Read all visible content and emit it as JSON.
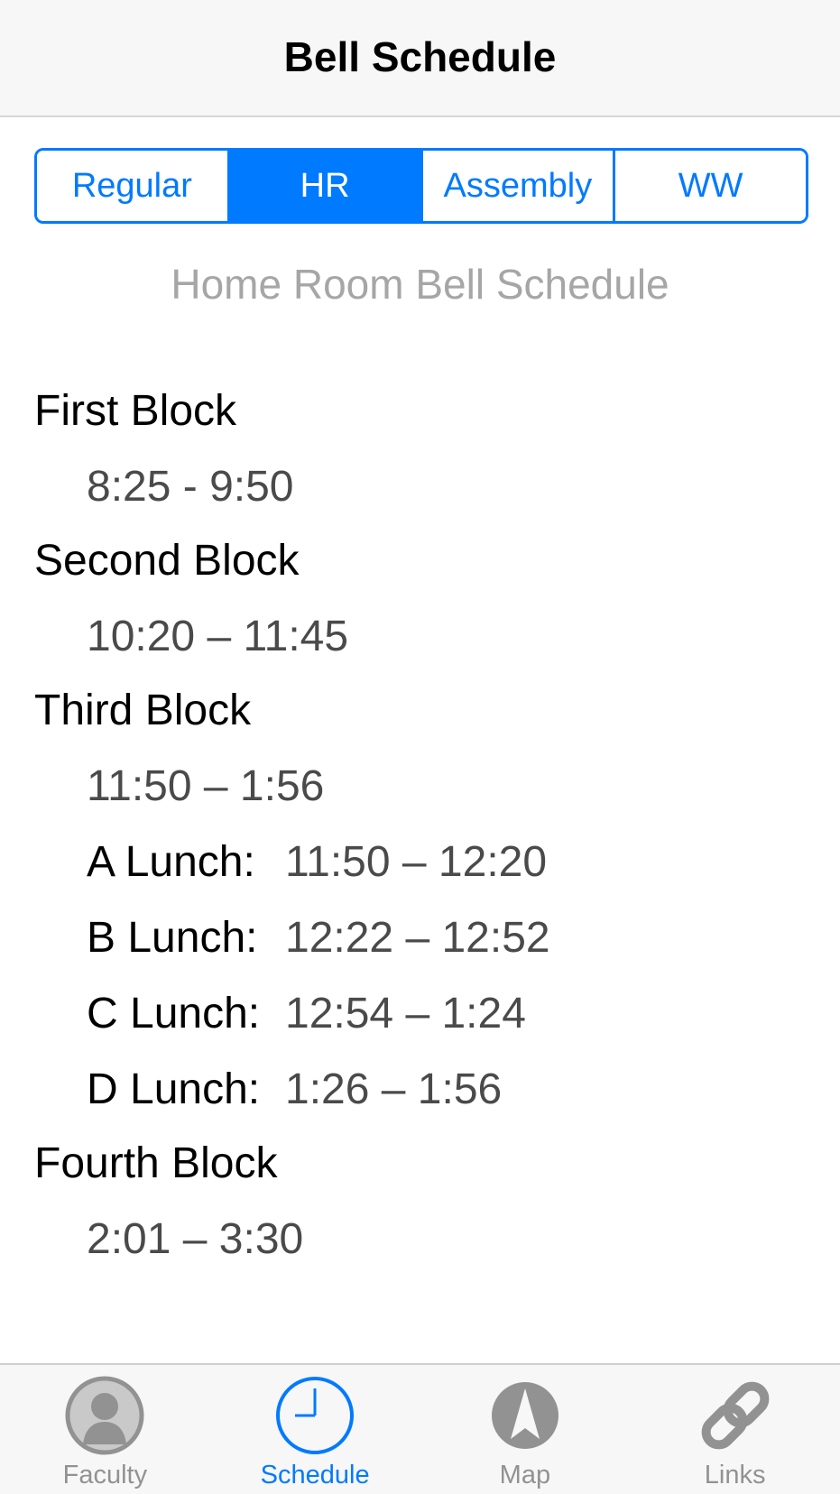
{
  "nav": {
    "title": "Bell Schedule"
  },
  "segments": [
    {
      "label": "Regular",
      "selected": false
    },
    {
      "label": "HR",
      "selected": true
    },
    {
      "label": "Assembly",
      "selected": false
    },
    {
      "label": "WW",
      "selected": false
    }
  ],
  "subtitle": "Home Room Bell Schedule",
  "schedule": {
    "first": {
      "name": "First Block",
      "time": "8:25 - 9:50"
    },
    "second": {
      "name": "Second Block",
      "time": "10:20 – 11:45"
    },
    "third": {
      "name": "Third Block",
      "time": "11:50 – 1:56",
      "lunches": [
        {
          "label": "A Lunch:",
          "time": "11:50 – 12:20"
        },
        {
          "label": "B Lunch:",
          "time": "12:22 – 12:52"
        },
        {
          "label": "C Lunch:",
          "time": "12:54 – 1:24"
        },
        {
          "label": "D Lunch:",
          "time": "1:26 – 1:56"
        }
      ]
    },
    "fourth": {
      "name": "Fourth Block",
      "time": "2:01 – 3:30"
    }
  },
  "tabbar": {
    "tabs": [
      {
        "label": "Faculty",
        "icon": "faculty-person-icon",
        "active": false
      },
      {
        "label": "Schedule",
        "icon": "clock-icon",
        "active": true
      },
      {
        "label": "Map",
        "icon": "compass-arrow-icon",
        "active": false
      },
      {
        "label": "Links",
        "icon": "chain-link-icon",
        "active": false
      }
    ]
  },
  "colors": {
    "accent": "#007aff",
    "inactive_tab": "#929292",
    "subtitle": "#a6a6a6",
    "time_text": "#4a4a4a",
    "bar_background": "#f7f7f7"
  }
}
